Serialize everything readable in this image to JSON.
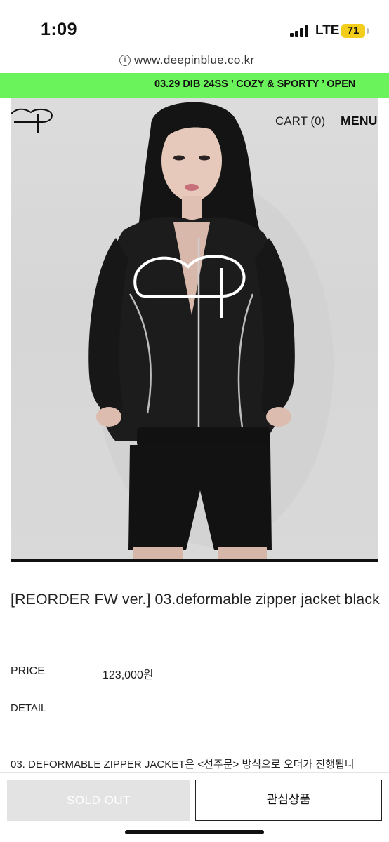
{
  "status_bar": {
    "time": "1:09",
    "network": "LTE",
    "battery": "71",
    "battery_color": "#f2cd1c"
  },
  "browser": {
    "url": "www.deepinblue.co.kr",
    "info_icon": "info-icon"
  },
  "banner": {
    "text": "03.29 DIB 24SS ’ COZY & SPORTY ’ OPEN",
    "color": "#6af35a"
  },
  "header": {
    "logo_icon": "brand-logo-icon",
    "cart_label": "CART (0)",
    "menu_label": "MENU"
  },
  "product": {
    "title": "[REORDER FW ver.] 03.deformable zipper jacket black",
    "price_label": "PRICE",
    "price_value": "123,000원",
    "detail_label": "DETAIL",
    "description": "03. DEFORMABLE ZIPPER JACKET은 <선주문> 방식으로 오더가 진행됩니"
  },
  "actions": {
    "sold_out_label": "SOLD OUT",
    "wishlist_label": "관심상품"
  }
}
